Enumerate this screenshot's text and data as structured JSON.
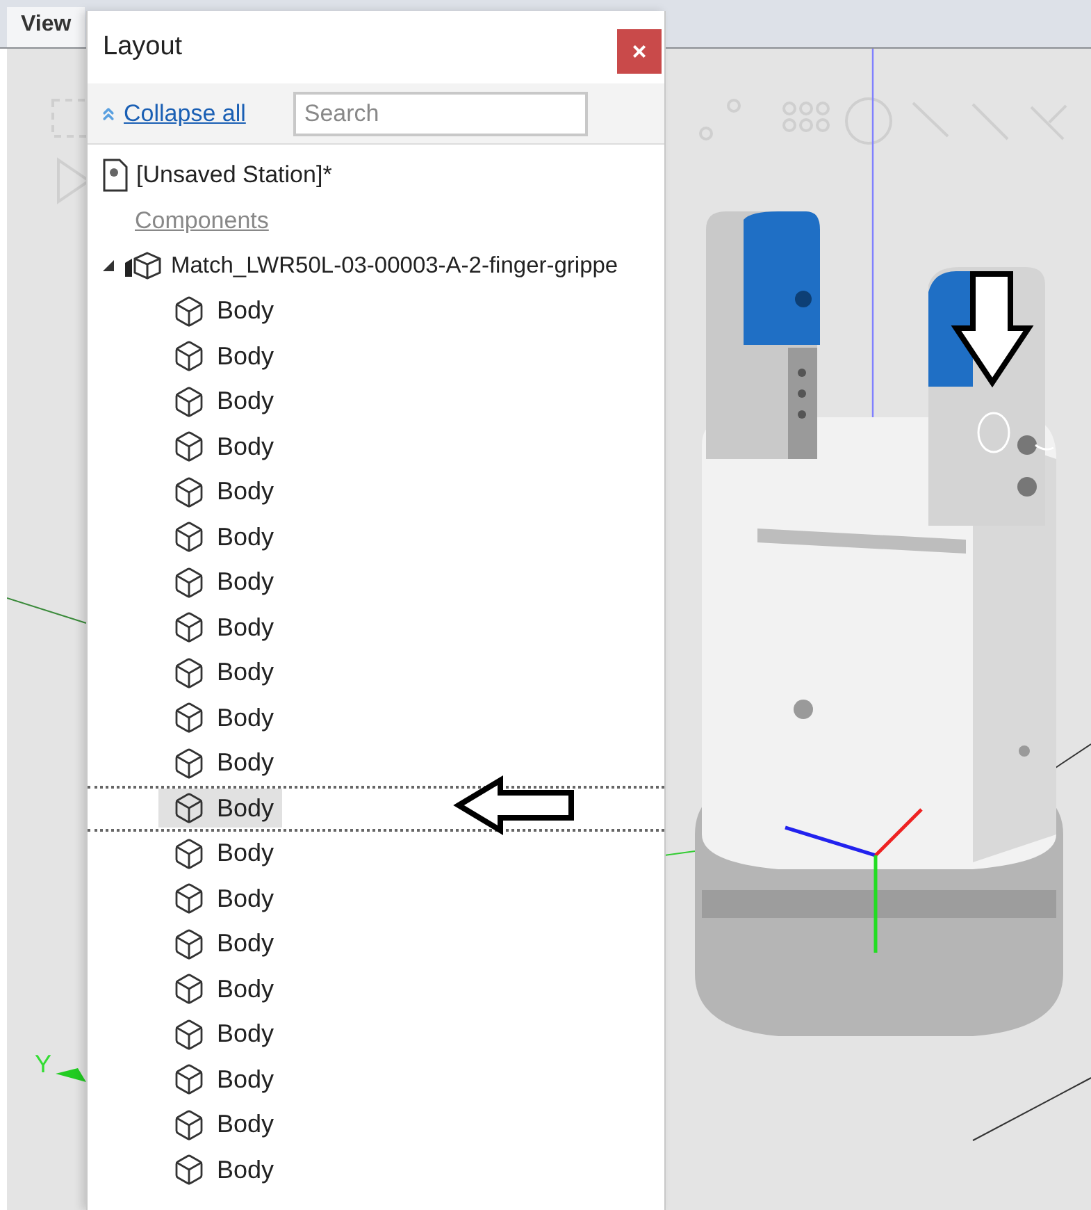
{
  "viewport": {
    "tab": "View",
    "axis_label": "Y"
  },
  "panel": {
    "title": "Layout",
    "close": "×",
    "collapse_all": "Collapse all",
    "search": {
      "placeholder": "Search"
    },
    "station": "[Unsaved Station]*",
    "section": "Components",
    "component": {
      "label": "Match_LWR50L-03-00003-A-2-finger-grippe",
      "expanded": true,
      "children": [
        {
          "label": "Body",
          "selected": false
        },
        {
          "label": "Body",
          "selected": false
        },
        {
          "label": "Body",
          "selected": false
        },
        {
          "label": "Body",
          "selected": false
        },
        {
          "label": "Body",
          "selected": false
        },
        {
          "label": "Body",
          "selected": false
        },
        {
          "label": "Body",
          "selected": false
        },
        {
          "label": "Body",
          "selected": false
        },
        {
          "label": "Body",
          "selected": false
        },
        {
          "label": "Body",
          "selected": false
        },
        {
          "label": "Body",
          "selected": false
        },
        {
          "label": "Body",
          "selected": true
        },
        {
          "label": "Body",
          "selected": false
        },
        {
          "label": "Body",
          "selected": false
        },
        {
          "label": "Body",
          "selected": false
        },
        {
          "label": "Body",
          "selected": false
        },
        {
          "label": "Body",
          "selected": false
        },
        {
          "label": "Body",
          "selected": false
        },
        {
          "label": "Body",
          "selected": false
        },
        {
          "label": "Body",
          "selected": false
        }
      ]
    }
  }
}
